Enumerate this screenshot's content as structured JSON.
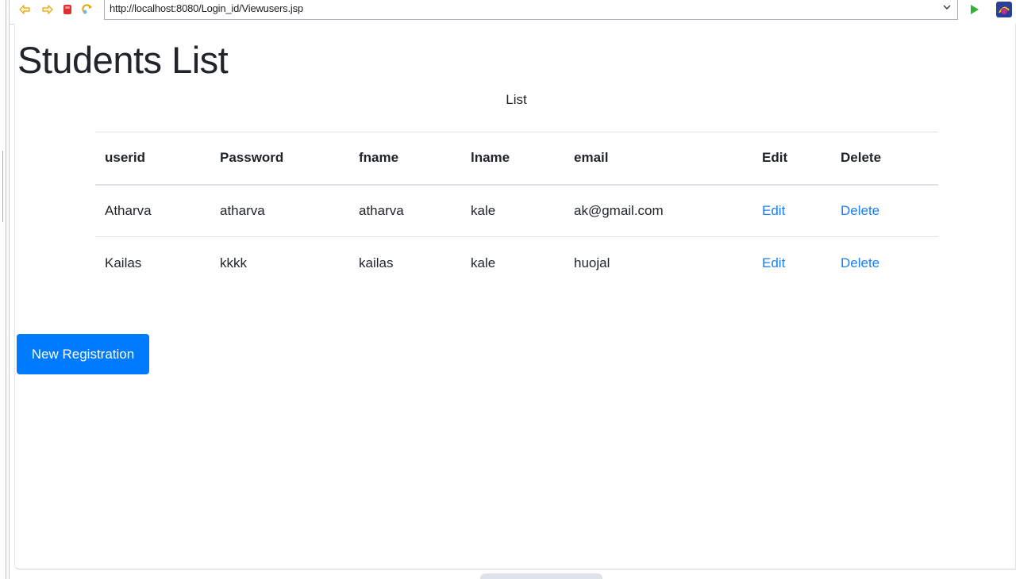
{
  "browser": {
    "url": "http://localhost:8080/Login_id/Viewusers.jsp",
    "icons": [
      "back-arrow-icon",
      "forward-arrow-icon",
      "stop-icon",
      "refresh-icon",
      "dropdown-chevron-icon",
      "go-play-icon",
      "extension-icon"
    ],
    "colors": {
      "go": "#33b233",
      "stop": "#e03030",
      "arrows": "#e8a800"
    }
  },
  "page": {
    "title": "Students List",
    "caption": "List"
  },
  "table": {
    "headers": [
      "userid",
      "Password",
      "fname",
      "lname",
      "email",
      "Edit",
      "Delete"
    ],
    "rows": [
      {
        "userid": "Atharva",
        "password": "atharva",
        "fname": "atharva",
        "lname": "kale",
        "email": "ak@gmail.com",
        "edit": "Edit",
        "delete": "Delete"
      },
      {
        "userid": "Kailas",
        "password": "kkkk",
        "fname": "kailas",
        "lname": "kale",
        "email": "huojal",
        "edit": "Edit",
        "delete": "Delete"
      }
    ],
    "link_color": "#1a7ff5"
  },
  "actions": {
    "new_registration": "New Registration",
    "button_color": "#007bff"
  }
}
